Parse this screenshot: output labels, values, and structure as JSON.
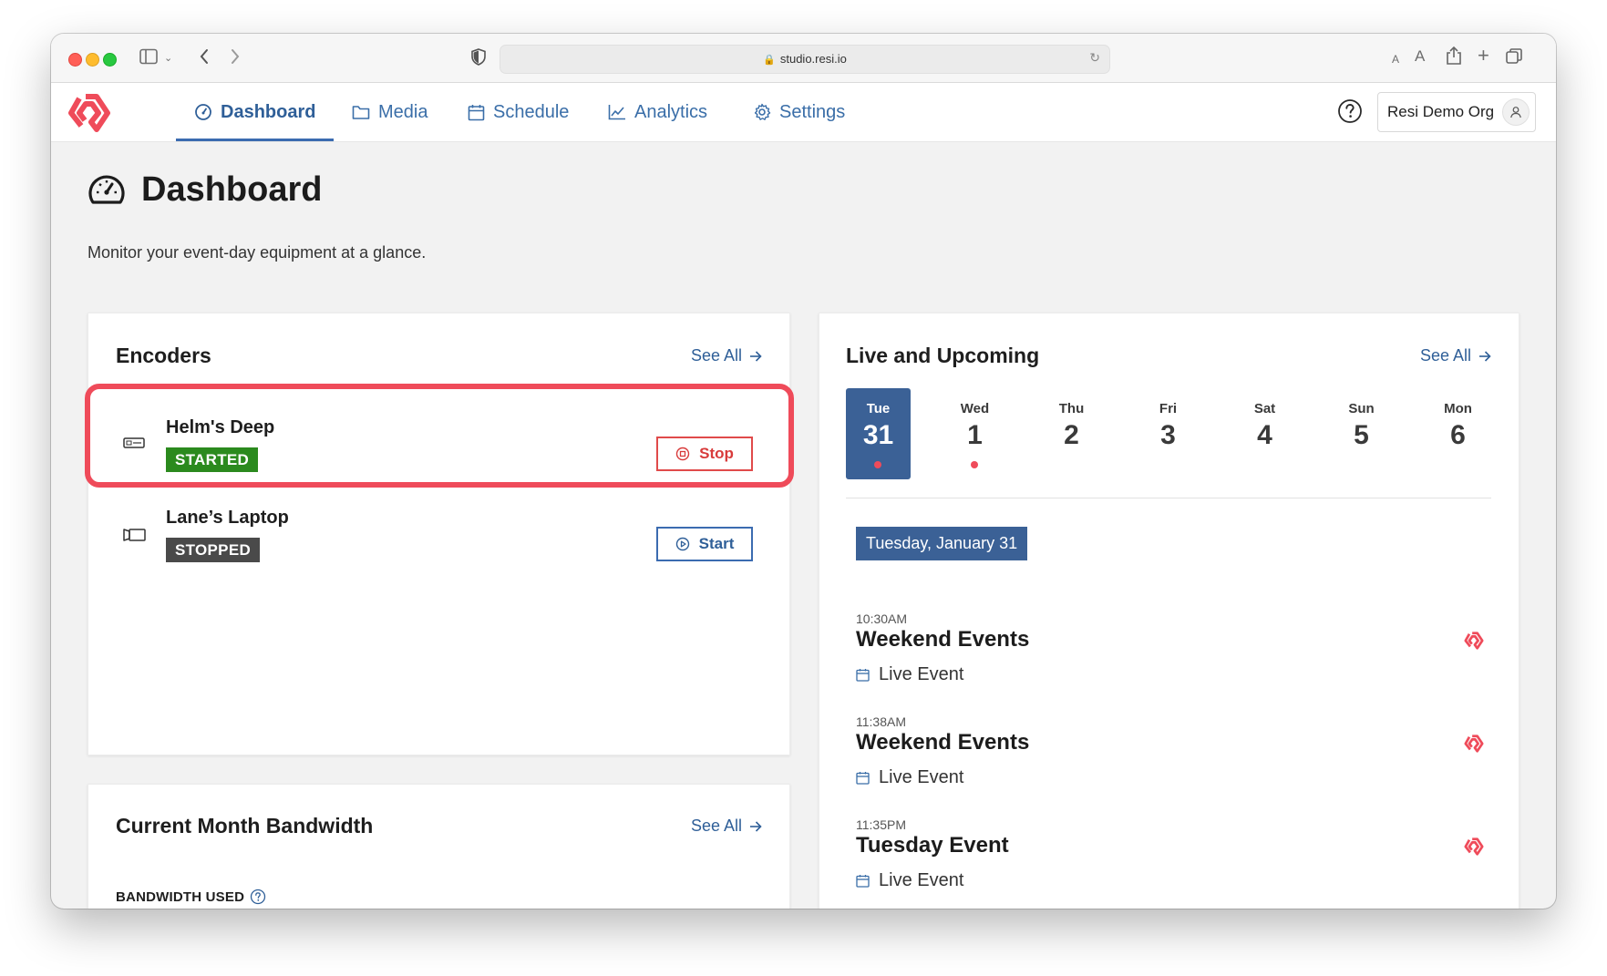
{
  "browser": {
    "url": "studio.resi.io"
  },
  "nav": {
    "items": [
      {
        "label": "Dashboard",
        "icon": "gauge-icon",
        "active": true
      },
      {
        "label": "Media",
        "icon": "folder-icon"
      },
      {
        "label": "Schedule",
        "icon": "calendar-icon"
      },
      {
        "label": "Analytics",
        "icon": "line-chart-icon"
      },
      {
        "label": "Settings",
        "icon": "gear-icon"
      }
    ],
    "org_name": "Resi Demo Org"
  },
  "page": {
    "title": "Dashboard",
    "subtitle": "Monitor your event-day equipment at a glance."
  },
  "encoders": {
    "title": "Encoders",
    "see_all": "See All",
    "items": [
      {
        "name": "Helm's Deep",
        "status": "STARTED",
        "action": "Stop",
        "icon": "encoder-device-icon"
      },
      {
        "name": "Lane’s Laptop",
        "status": "STOPPED",
        "action": "Start",
        "icon": "laptop-encoder-icon"
      }
    ]
  },
  "bandwidth": {
    "title": "Current Month Bandwidth",
    "see_all": "See All",
    "used_label": "BANDWIDTH USED"
  },
  "live": {
    "title": "Live and Upcoming",
    "see_all": "See All",
    "days": [
      {
        "name": "Tue",
        "num": "31",
        "selected": true,
        "has_event": true
      },
      {
        "name": "Wed",
        "num": "1",
        "selected": false,
        "has_event": true
      },
      {
        "name": "Thu",
        "num": "2",
        "selected": false,
        "has_event": false
      },
      {
        "name": "Fri",
        "num": "3",
        "selected": false,
        "has_event": false
      },
      {
        "name": "Sat",
        "num": "4",
        "selected": false,
        "has_event": false
      },
      {
        "name": "Sun",
        "num": "5",
        "selected": false,
        "has_event": false
      },
      {
        "name": "Mon",
        "num": "6",
        "selected": false,
        "has_event": false
      }
    ],
    "selected_date": "Tuesday, January 31",
    "events": [
      {
        "time": "10:30AM",
        "title": "Weekend Events",
        "type": "Live Event"
      },
      {
        "time": "11:38AM",
        "title": "Weekend Events",
        "type": "Live Event"
      },
      {
        "time": "11:35PM",
        "title": "Tuesday Event",
        "type": "Live Event"
      }
    ]
  },
  "colors": {
    "brand_red": "#ef4b5a",
    "nav_blue": "#2f5f98",
    "selected_day": "#3b6196",
    "started_green": "#2b8a1e",
    "stopped_gray": "#4a4a4a"
  }
}
